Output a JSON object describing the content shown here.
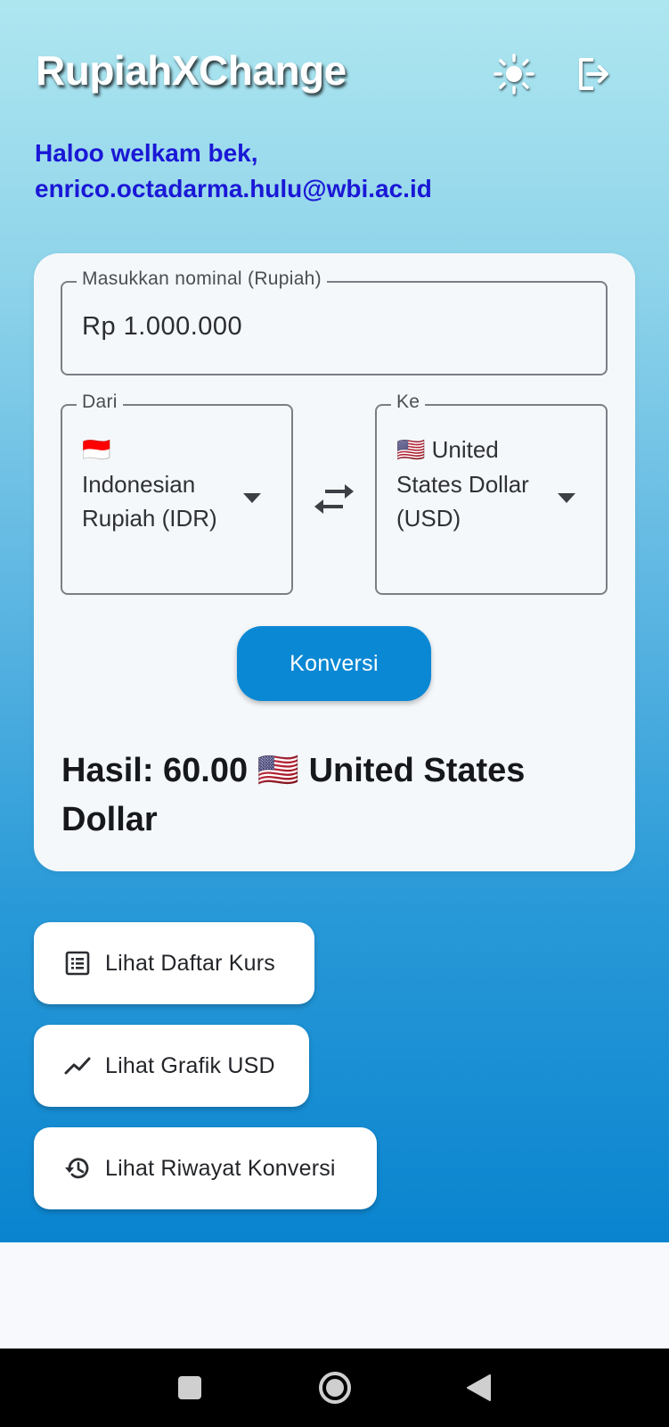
{
  "app": {
    "title": "RupiahXChange",
    "icons": {
      "theme": "sun-icon",
      "logout": "logout-icon"
    }
  },
  "greeting": {
    "line1": "Haloo welkam bek,",
    "email": "enrico.octadarma.hulu@wbi.ac.id"
  },
  "converter": {
    "amount_label": "Masukkan nominal (Rupiah)",
    "amount_value": "Rp 1.000.000",
    "from_label": "Dari",
    "from_flag": "🇮🇩",
    "from_value": "Indonesian Rupiah (IDR)",
    "to_label": "Ke",
    "to_flag": "🇺🇸",
    "to_value": "United States Dollar (USD)",
    "convert_button": "Konversi",
    "result_prefix": "Hasil: 60.00",
    "result_flag": "🇺🇸",
    "result_currency": "United States Dollar"
  },
  "actions": [
    {
      "label": "Lihat Daftar Kurs",
      "icon": "list-icon"
    },
    {
      "label": "Lihat Grafik USD",
      "icon": "chart-line-icon"
    },
    {
      "label": "Lihat Riwayat Konversi",
      "icon": "history-icon"
    }
  ],
  "colors": {
    "accent": "#0b88d4",
    "greeting": "#1a17d6",
    "gradient_top": "#aee6f0",
    "gradient_bottom": "#0a84cf"
  }
}
